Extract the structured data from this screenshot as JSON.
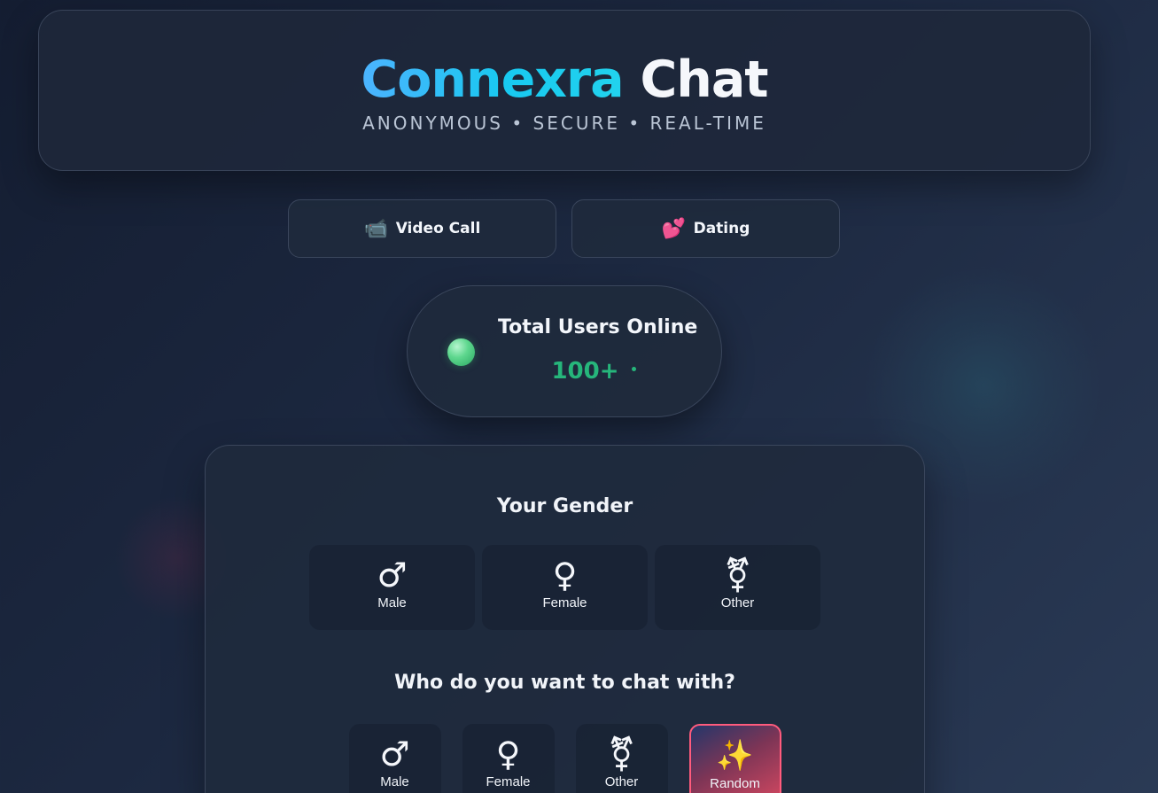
{
  "header": {
    "title_brand": "Connexra",
    "title_rest": "Chat",
    "tagline": "ANONYMOUS • SECURE • REAL-TIME"
  },
  "modes": [
    {
      "label": "Video Call",
      "icon": "video-camera-icon",
      "glyph": "📹"
    },
    {
      "label": "Dating",
      "icon": "two-hearts-icon",
      "glyph": "💕"
    }
  ],
  "stats": {
    "title": "Total Users Online",
    "count": "100+"
  },
  "your_gender": {
    "title": "Your Gender",
    "options": [
      {
        "label": "Male",
        "icon": "male-symbol-icon",
        "glyph": "♂"
      },
      {
        "label": "Female",
        "icon": "female-symbol-icon",
        "glyph": "♀"
      },
      {
        "label": "Other",
        "icon": "transgender-symbol-icon",
        "glyph": "⚧"
      }
    ]
  },
  "chat_with": {
    "title": "Who do you want to chat with?",
    "options": [
      {
        "label": "Male",
        "icon": "male-symbol-icon",
        "glyph": "♂"
      },
      {
        "label": "Female",
        "icon": "female-symbol-icon",
        "glyph": "♀"
      },
      {
        "label": "Other",
        "icon": "transgender-symbol-icon",
        "glyph": "⚧"
      },
      {
        "label": "Random",
        "icon": "sparkles-icon",
        "glyph": "✨",
        "selected": true
      }
    ]
  },
  "colors": {
    "accent": "#22d3ee",
    "online": "#26b67b",
    "random_border": "#ff5b7d"
  }
}
